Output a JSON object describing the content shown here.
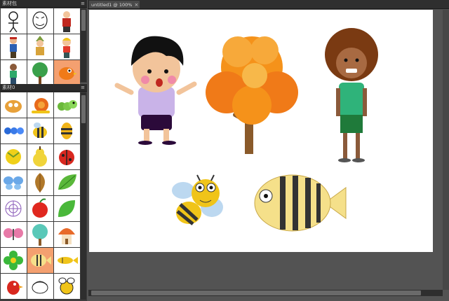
{
  "panel_top": {
    "title": "素材包",
    "menu_icon": "panel-menu-icon",
    "menu_glyph": "≡"
  },
  "panel_bottom": {
    "title": "素材0",
    "menu_icon": "panel-menu-icon",
    "menu_glyph": "≡"
  },
  "panel_top_items": [
    "stick-figure",
    "sketch-face",
    "red-shirt-man",
    "bandana-boy",
    "gnome-girl",
    "blonde-boy",
    "green-shirt-boy",
    "green-tree",
    "orange-bird"
  ],
  "panel_bottom_items": [
    "snail-bug",
    "orange-snail",
    "green-caterpillar",
    "blue-ant",
    "cartoon-bee",
    "striped-bee",
    "yellow-bug",
    "yellow-pear",
    "ladybug",
    "blue-butterfly",
    "brown-leaf",
    "green-leaf",
    "spider-web",
    "red-apple",
    "green-leaf-2",
    "pink-butterfly",
    "teal-tree",
    "mushroom-house",
    "green-flower",
    "striped-fish",
    "yellow-fish",
    "red-bird",
    "white-bird",
    "bee-outline"
  ],
  "document": {
    "tab_label": "untitled1 @ 100%",
    "close_glyph": "×"
  },
  "canvas_items": [
    "waving-boy",
    "autumn-tree",
    "curly-hair-man",
    "cartoon-bee",
    "striped-fish"
  ],
  "colors": {
    "selected_cell": "#f4a070",
    "panel_bg": "#3c3c3c",
    "workspace": "#535353"
  }
}
